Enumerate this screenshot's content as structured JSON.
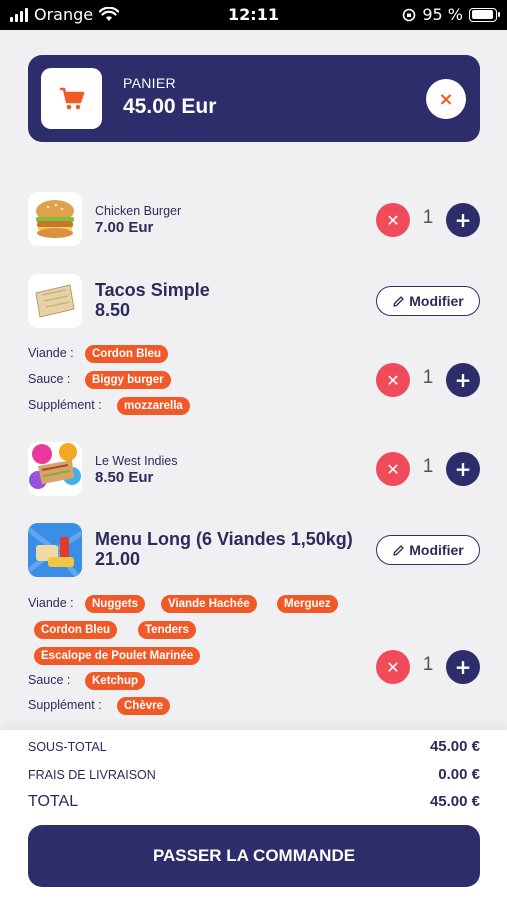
{
  "status_bar": {
    "carrier": "Orange",
    "time": "12:11",
    "battery": "95 %"
  },
  "cart": {
    "title": "PANIER",
    "total": "45.00 Eur",
    "close_label": "×"
  },
  "controls": {
    "minus": "✕",
    "plus": "+",
    "modify": "Modifier"
  },
  "items": [
    {
      "name": "Chicken Burger",
      "price": "7.00 Eur",
      "qty": "1"
    },
    {
      "name": "Tacos Simple",
      "price": "8.50",
      "qty": "1",
      "options": [
        {
          "label": "Viande :",
          "tags": [
            "Cordon Bleu"
          ]
        },
        {
          "label": "Sauce :",
          "tags": [
            "Biggy burger"
          ]
        },
        {
          "label": "Supplément :",
          "tags": [
            "mozzarella"
          ]
        }
      ]
    },
    {
      "name": "Le West Indies",
      "price": "8.50 Eur",
      "qty": "1"
    },
    {
      "name": "Menu Long (6 Viandes 1,50kg)",
      "price": "21.00",
      "qty": "1",
      "options": [
        {
          "label": "Viande :",
          "tags": [
            "Nuggets",
            "Viande Hachée",
            "Merguez",
            "Cordon Bleu",
            "Tenders",
            "Escalope de Poulet Marinée"
          ]
        },
        {
          "label": "Sauce :",
          "tags": [
            "Ketchup"
          ]
        },
        {
          "label": "Supplément :",
          "tags": [
            "Chèvre"
          ]
        }
      ]
    }
  ],
  "summary": {
    "subtotal_label": "SOUS-TOTAL",
    "subtotal": "45.00 €",
    "delivery_label": "FRAIS DE LIVRAISON",
    "delivery": "0.00 €",
    "total_label": "TOTAL",
    "total": "45.00 €"
  },
  "checkout_label": "PASSER LA COMMANDE",
  "colors": {
    "navy": "#2d2d6b",
    "orange": "#f05a28",
    "red": "#f04b5a",
    "background": "#f0f0f2"
  }
}
